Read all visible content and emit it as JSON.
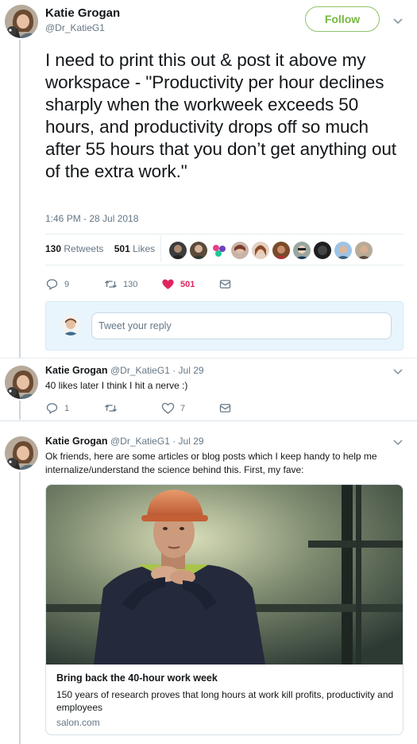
{
  "main_tweet": {
    "name": "Katie Grogan",
    "handle": "@Dr_KatieG1",
    "follow_label": "Follow",
    "text": "I need to print this out & post it above my workspace - \"Productivity per hour declines sharply when the workweek exceeds 50  hours, and productivity drops off so much after 55 hours that you don’t  get anything out of the extra work.\"",
    "timestamp": "1:46 PM - 28 Jul 2018",
    "retweet_count": "130",
    "retweet_label": "Retweets",
    "like_count": "501",
    "like_label": "Likes",
    "actions": {
      "reply": "9",
      "retweet": "130",
      "like": "501"
    }
  },
  "reply_box": {
    "placeholder": "Tweet your reply"
  },
  "replies": [
    {
      "name": "Katie Grogan",
      "meta": "@Dr_KatieG1 · Jul 29",
      "text": "40 likes later I think I hit a nerve :)",
      "actions": {
        "reply": "1",
        "retweet": "",
        "like": "7"
      }
    },
    {
      "name": "Katie Grogan",
      "meta": "@Dr_KatieG1 · Jul 29",
      "text": "Ok friends, here are some articles or blog posts which I keep handy to help me internalize/understand the science behind this.  First, my fave:",
      "card": {
        "title": "Bring back the 40-hour work week",
        "description": "150 years of research proves that long hours at work kill profits, productivity and employees",
        "domain": "salon.com"
      }
    }
  ],
  "colors": {
    "follow": "#76b83f",
    "like_active": "#e0245e",
    "secondary_text": "#657786",
    "reply_box_bg": "#e8f5fd"
  },
  "icons": [
    "reply-icon",
    "retweet-icon",
    "heart-icon",
    "direct-message-icon",
    "chevron-down-icon"
  ]
}
